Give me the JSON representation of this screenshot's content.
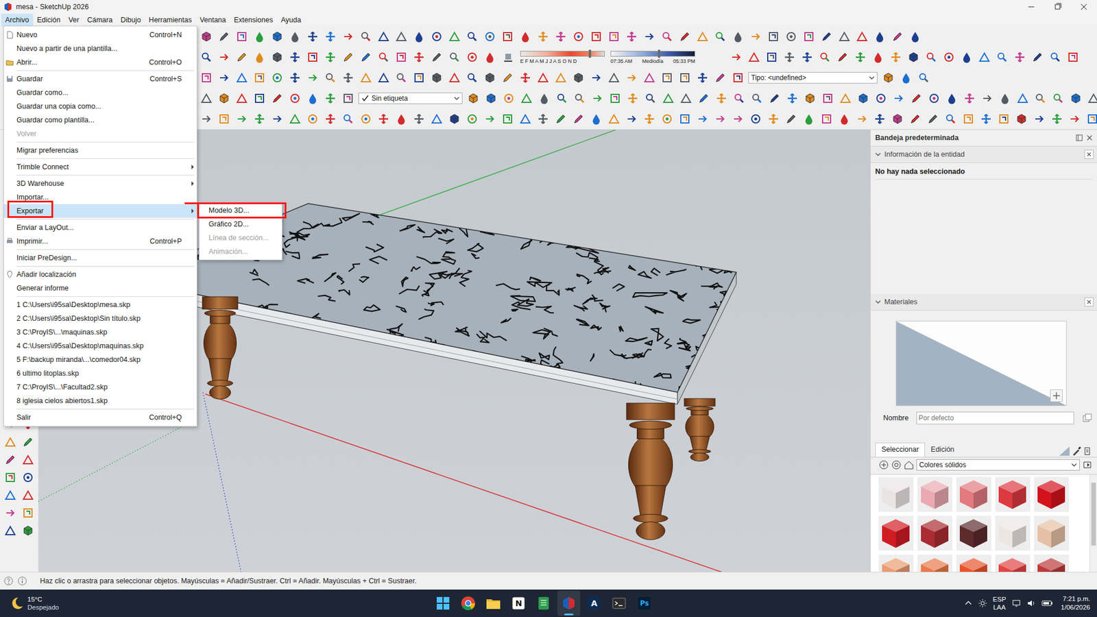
{
  "window": {
    "title": "mesa - SketchUp 2026"
  },
  "menubar": [
    {
      "label": "Archivo",
      "selected": true
    },
    {
      "label": "Edición",
      "selected": false
    },
    {
      "label": "Ver",
      "selected": false
    },
    {
      "label": "Cámara",
      "selected": false
    },
    {
      "label": "Dibujo",
      "selected": false
    },
    {
      "label": "Herramientas",
      "selected": false
    },
    {
      "label": "Ventana",
      "selected": false
    },
    {
      "label": "Extensiones",
      "selected": false
    },
    {
      "label": "Ayuda",
      "selected": false
    }
  ],
  "file_menu": {
    "items": [
      {
        "kind": "item",
        "label": "Nuevo",
        "shortcut": "Control+N",
        "disabled": false,
        "selected": false,
        "annotated": false
      },
      {
        "kind": "item",
        "label": "Nuevo a partir de una plantilla...",
        "shortcut": "",
        "disabled": false,
        "selected": false,
        "annotated": false
      },
      {
        "kind": "item",
        "label": "Abrir...",
        "shortcut": "Control+O",
        "disabled": false,
        "selected": false,
        "annotated": false
      },
      {
        "kind": "separator"
      },
      {
        "kind": "item",
        "label": "Guardar",
        "shortcut": "Control+S",
        "disabled": false,
        "selected": false,
        "annotated": false
      },
      {
        "kind": "item",
        "label": "Guardar como...",
        "shortcut": "",
        "disabled": false,
        "selected": false,
        "annotated": false
      },
      {
        "kind": "item",
        "label": "Guardar una copia como...",
        "shortcut": "",
        "disabled": false,
        "selected": false,
        "annotated": false
      },
      {
        "kind": "item",
        "label": "Guardar como plantilla...",
        "shortcut": "",
        "disabled": false,
        "selected": false,
        "annotated": false
      },
      {
        "kind": "item",
        "label": "Volver",
        "shortcut": "",
        "disabled": true,
        "selected": false,
        "annotated": false
      },
      {
        "kind": "separator"
      },
      {
        "kind": "item",
        "label": "Migrar preferencias",
        "shortcut": "",
        "disabled": false,
        "selected": false,
        "annotated": false
      },
      {
        "kind": "separator"
      },
      {
        "kind": "submenu",
        "label": "Trimble Connect",
        "shortcut": "",
        "disabled": false,
        "selected": false,
        "annotated": false
      },
      {
        "kind": "separator"
      },
      {
        "kind": "submenu",
        "label": "3D Warehouse",
        "shortcut": "",
        "disabled": false,
        "selected": false,
        "annotated": false
      },
      {
        "kind": "item",
        "label": "Importar...",
        "shortcut": "",
        "disabled": false,
        "selected": false,
        "annotated": false
      },
      {
        "kind": "submenu",
        "label": "Exportar",
        "shortcut": "",
        "disabled": false,
        "selected": true,
        "annotated": true
      },
      {
        "kind": "separator"
      },
      {
        "kind": "item",
        "label": "Enviar a LayOut...",
        "shortcut": "",
        "disabled": false,
        "selected": false,
        "annotated": false
      },
      {
        "kind": "item",
        "label": "Imprimir...",
        "shortcut": "Control+P",
        "disabled": false,
        "selected": false,
        "annotated": false
      },
      {
        "kind": "separator"
      },
      {
        "kind": "item",
        "label": "Iniciar PreDesign...",
        "shortcut": "",
        "disabled": false,
        "selected": false,
        "annotated": false
      },
      {
        "kind": "separator"
      },
      {
        "kind": "item",
        "label": "Añadir localización",
        "shortcut": "",
        "disabled": false,
        "selected": false,
        "annotated": false
      },
      {
        "kind": "item",
        "label": "Generar informe",
        "shortcut": "",
        "disabled": false,
        "selected": false,
        "annotated": false
      },
      {
        "kind": "separator"
      },
      {
        "kind": "item",
        "label": "1 C:\\Users\\i95sa\\Desktop\\mesa.skp",
        "shortcut": "",
        "disabled": false,
        "selected": false,
        "annotated": false
      },
      {
        "kind": "item",
        "label": "2 C:\\Users\\i95sa\\Desktop\\Sin título.skp",
        "shortcut": "",
        "disabled": false,
        "selected": false,
        "annotated": false
      },
      {
        "kind": "item",
        "label": "3 C:\\ProyIS\\...\\maquinas.skp",
        "shortcut": "",
        "disabled": false,
        "selected": false,
        "annotated": false
      },
      {
        "kind": "item",
        "label": "4 C:\\Users\\i95sa\\Desktop\\maquinas.skp",
        "shortcut": "",
        "disabled": false,
        "selected": false,
        "annotated": false
      },
      {
        "kind": "item",
        "label": "5 F:\\backup miranda\\...\\comedor04.skp",
        "shortcut": "",
        "disabled": false,
        "selected": false,
        "annotated": false
      },
      {
        "kind": "item",
        "label": "6 ultimo litoplas.skp",
        "shortcut": "",
        "disabled": false,
        "selected": false,
        "annotated": false
      },
      {
        "kind": "item",
        "label": "7 C:\\ProyIS\\...\\Facultad2.skp",
        "shortcut": "",
        "disabled": false,
        "selected": false,
        "annotated": false
      },
      {
        "kind": "item",
        "label": "8 iglesia cielos abiertos1.skp",
        "shortcut": "",
        "disabled": false,
        "selected": false,
        "annotated": false
      },
      {
        "kind": "separator"
      },
      {
        "kind": "item",
        "label": "Salir",
        "shortcut": "Control+Q",
        "disabled": false,
        "selected": false,
        "annotated": false
      }
    ]
  },
  "export_menu": {
    "items": [
      {
        "label": "Modelo 3D...",
        "disabled": false,
        "annotated": true
      },
      {
        "label": "Gráfico 2D...",
        "disabled": false,
        "annotated": false
      },
      {
        "label": "Línea de sección...",
        "disabled": true,
        "annotated": false
      },
      {
        "label": "Animación...",
        "disabled": true,
        "annotated": false
      }
    ]
  },
  "toolbar": {
    "shadow_settings": {
      "months": "E F M A M J J A S O N D",
      "date_level": 0.84,
      "time_start": "07:35 AM",
      "time_mid": "Mediodía",
      "time_end": "05:33 PM",
      "time_level": 0.59
    },
    "type_dropdown": {
      "value": "Tipo: <undefined>"
    },
    "tag_dropdown": {
      "value": "Sin etiqueta",
      "visible": true
    }
  },
  "tray": {
    "title": "Bandeja predeterminada",
    "entity_info": {
      "title": "Información de la entidad",
      "expanded": true,
      "message": "No hay nada seleccionado"
    },
    "materials": {
      "title": "Materiales",
      "expanded": true,
      "name_label": "Nombre",
      "name_placeholder": "Por defecto",
      "tabs": [
        {
          "label": "Seleccionar",
          "selected": true
        },
        {
          "label": "Edición",
          "selected": false
        }
      ],
      "library": "Colores sólidos",
      "swatches": [
        {
          "color": "#ece3e5"
        },
        {
          "color": "#eaa9b0"
        },
        {
          "color": "#e27a80"
        },
        {
          "color": "#dc3a40"
        },
        {
          "color": "#d4121c"
        },
        {
          "color": "#d21c24"
        },
        {
          "color": "#ab2c33"
        },
        {
          "color": "#5e2b2d"
        },
        {
          "color": "#ece6e2"
        },
        {
          "color": "#e6c0a6"
        },
        {
          "color": "#eb9c72"
        },
        {
          "color": "#ea7a4a"
        },
        {
          "color": "#e8552c"
        },
        {
          "color": "#e24444"
        },
        {
          "color": "#bb3a3a"
        }
      ]
    }
  },
  "status_bar": {
    "text": "Haz clic o arrastra para seleccionar objetos. Mayúsculas = Añadir/Sustraer. Ctrl = Añadir. Mayúsculas + Ctrl = Sustraer."
  },
  "taskbar": {
    "weather": {
      "temp": "15°C",
      "condition": "Despejado"
    },
    "apps": [
      {
        "label": "",
        "active": false
      },
      {
        "label": "",
        "active": false
      },
      {
        "label": "",
        "active": false
      },
      {
        "label": "N",
        "active": false
      },
      {
        "label": "",
        "active": false
      },
      {
        "label": "",
        "active": true
      },
      {
        "label": "A",
        "active": false
      },
      {
        "label": "",
        "active": false
      },
      {
        "label": "Ps",
        "active": false
      }
    ],
    "language": "ESP",
    "layout": "LAA",
    "time": "7:21 p.m.",
    "date": "1/06/2026"
  }
}
